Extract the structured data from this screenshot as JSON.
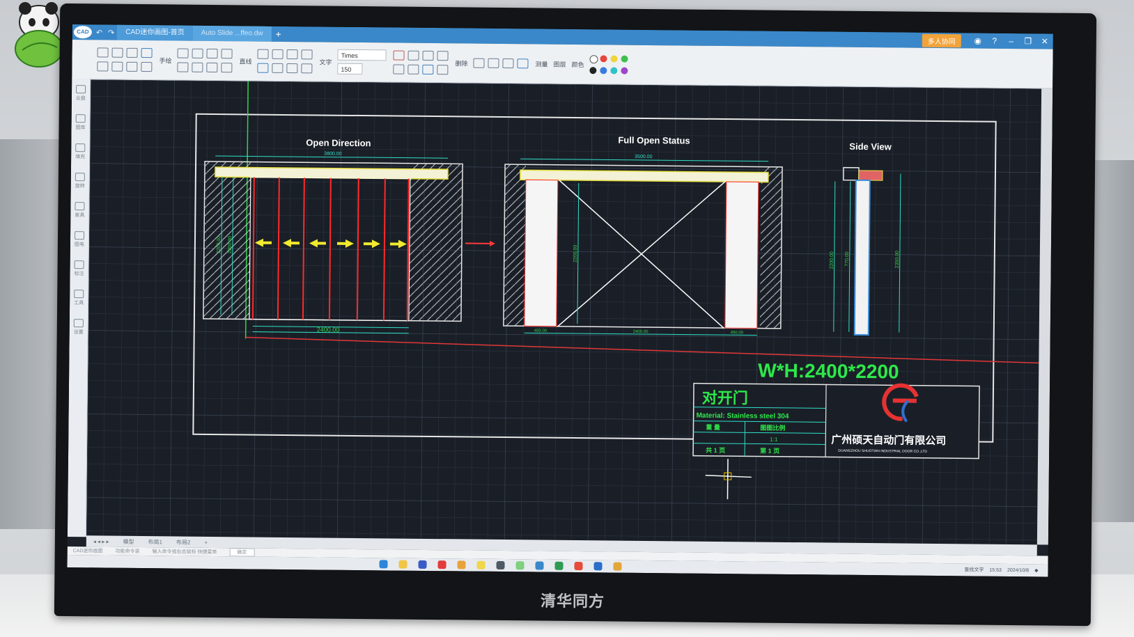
{
  "app": {
    "tabs": [
      {
        "label": "CAD迷你画图-首页"
      },
      {
        "label": "Auto Slide ...ffeo.dw"
      }
    ],
    "collab_label": "多人协同",
    "ribbon_labels": [
      "手绘",
      "直线",
      "文字",
      "删除",
      "测量",
      "图层",
      "颜色"
    ],
    "font_name": "Times",
    "font_size": "150",
    "left_tools": [
      "云盘",
      "图库",
      "填充",
      "旋转",
      "家具",
      "图电",
      "标注",
      "工具",
      "设置"
    ],
    "sheet_tabs": [
      "模型",
      "布局1",
      "布局2"
    ],
    "status": {
      "left": "CAD迷你画图",
      "mode": "功能命令录",
      "hint": "输入命令或右击鼠标 快捷菜单",
      "confirm": "确定"
    },
    "search_label": "查找文字",
    "clock": {
      "time": "15:53",
      "date": "2024/10/8"
    },
    "monitor_brand": "清华同方"
  },
  "drawing": {
    "view_titles": {
      "open_direction": "Open Direction",
      "full_open": "Full Open Status",
      "side_view": "Side View"
    },
    "dimensions": {
      "od_top": "3800.00",
      "od_bottom": "2400.00",
      "od_height_1": "2200.00",
      "od_height_2": "2200.00",
      "fo_top": "3500.00",
      "fo_height": "2200.00",
      "fo_left": "450.00",
      "fo_mid": "2400.00",
      "fo_right": "450.00",
      "sv_h1": "2200.00",
      "sv_h2": "770.00",
      "sv_h3": "2350.00"
    },
    "size_text": "W*H:2400*2200",
    "title_block": {
      "door_type": "对开门",
      "material": "Material: Stainless steel 304",
      "weight_label": "重 量",
      "scale_label": "图图比例",
      "scale_value": "1:1",
      "total_sheets": "共 1 页",
      "sheet_no": "第 1 页",
      "company_cn": "广州硕天自动门有限公司",
      "company_en": "GUANGZHOU SHUOTIAN INDUSTRIAL DOOR CO.,LTD"
    }
  }
}
